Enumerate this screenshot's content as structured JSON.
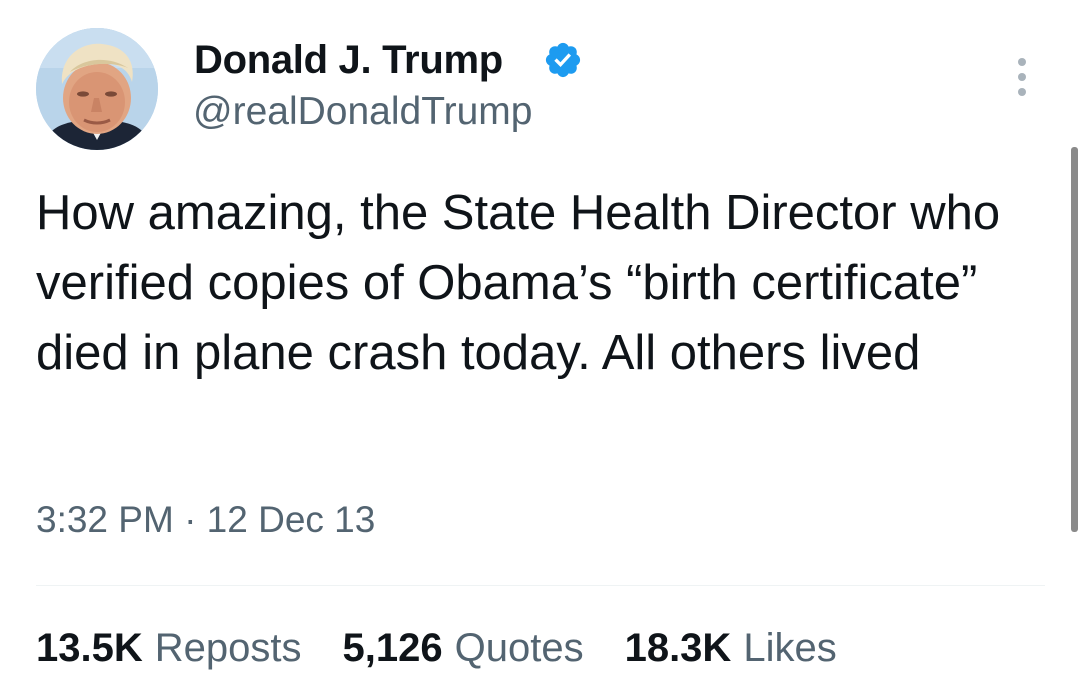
{
  "author": {
    "display_name": "Donald J. Trump",
    "handle": "@realDonaldTrump",
    "verified": true
  },
  "tweet": {
    "text": "How amazing, the State Health Director who verified copies of Obama’s “birth certificate” died in plane crash today. All others lived",
    "timestamp": "3:32 PM · 12 Dec 13"
  },
  "stats": [
    {
      "value": "13.5K",
      "label": "Reposts"
    },
    {
      "value": "5,126",
      "label": "Quotes"
    },
    {
      "value": "18.3K",
      "label": "Likes"
    }
  ],
  "icons": {
    "verified": "verified-badge-icon",
    "more": "more-options-icon"
  },
  "colors": {
    "verified_blue": "#1d9bf0",
    "secondary_text": "#536471",
    "primary_text": "#0f1419"
  }
}
